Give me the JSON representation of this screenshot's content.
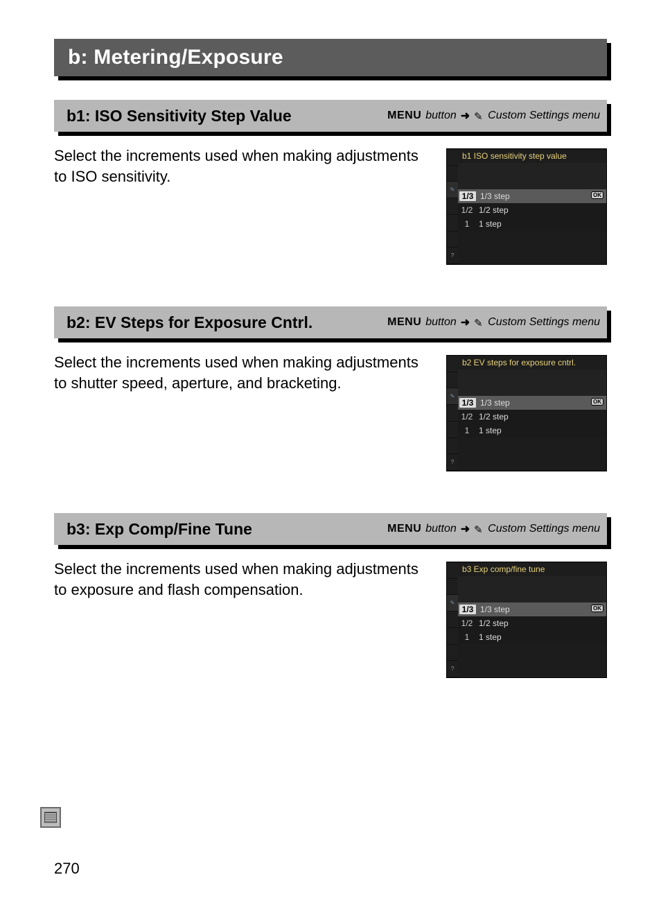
{
  "section_title": "b: Metering/Exposure",
  "breadcrumb": {
    "menu": "MENU",
    "button_word": "button",
    "arrow": "➜",
    "target": "Custom Settings menu"
  },
  "items": [
    {
      "heading": "b1: ISO Sensitivity Step Value",
      "desc": "Select the increments used when making adjustments to ISO sensitivity.",
      "lcd_title": "b1 ISO sensitivity step value",
      "options": [
        {
          "key": "1/3",
          "label": "1/3 step",
          "selected": true
        },
        {
          "key": "1/2",
          "label": "1/2 step",
          "selected": false
        },
        {
          "key": "1",
          "label": "1 step",
          "selected": false
        }
      ]
    },
    {
      "heading": "b2: EV Steps for Exposure Cntrl.",
      "desc": "Select the increments used when making adjustments to shutter speed, aperture, and bracketing.",
      "lcd_title": "b2 EV steps for exposure cntrl.",
      "options": [
        {
          "key": "1/3",
          "label": "1/3 step",
          "selected": true
        },
        {
          "key": "1/2",
          "label": "1/2 step",
          "selected": false
        },
        {
          "key": "1",
          "label": "1 step",
          "selected": false
        }
      ]
    },
    {
      "heading": "b3: Exp Comp/Fine Tune",
      "desc": "Select the increments used when making adjustments to exposure and flash compensation.",
      "lcd_title": "b3 Exp comp/fine tune",
      "options": [
        {
          "key": "1/3",
          "label": "1/3 step",
          "selected": true
        },
        {
          "key": "1/2",
          "label": "1/2 step",
          "selected": false
        },
        {
          "key": "1",
          "label": "1 step",
          "selected": false
        }
      ]
    }
  ],
  "page_number": "270"
}
